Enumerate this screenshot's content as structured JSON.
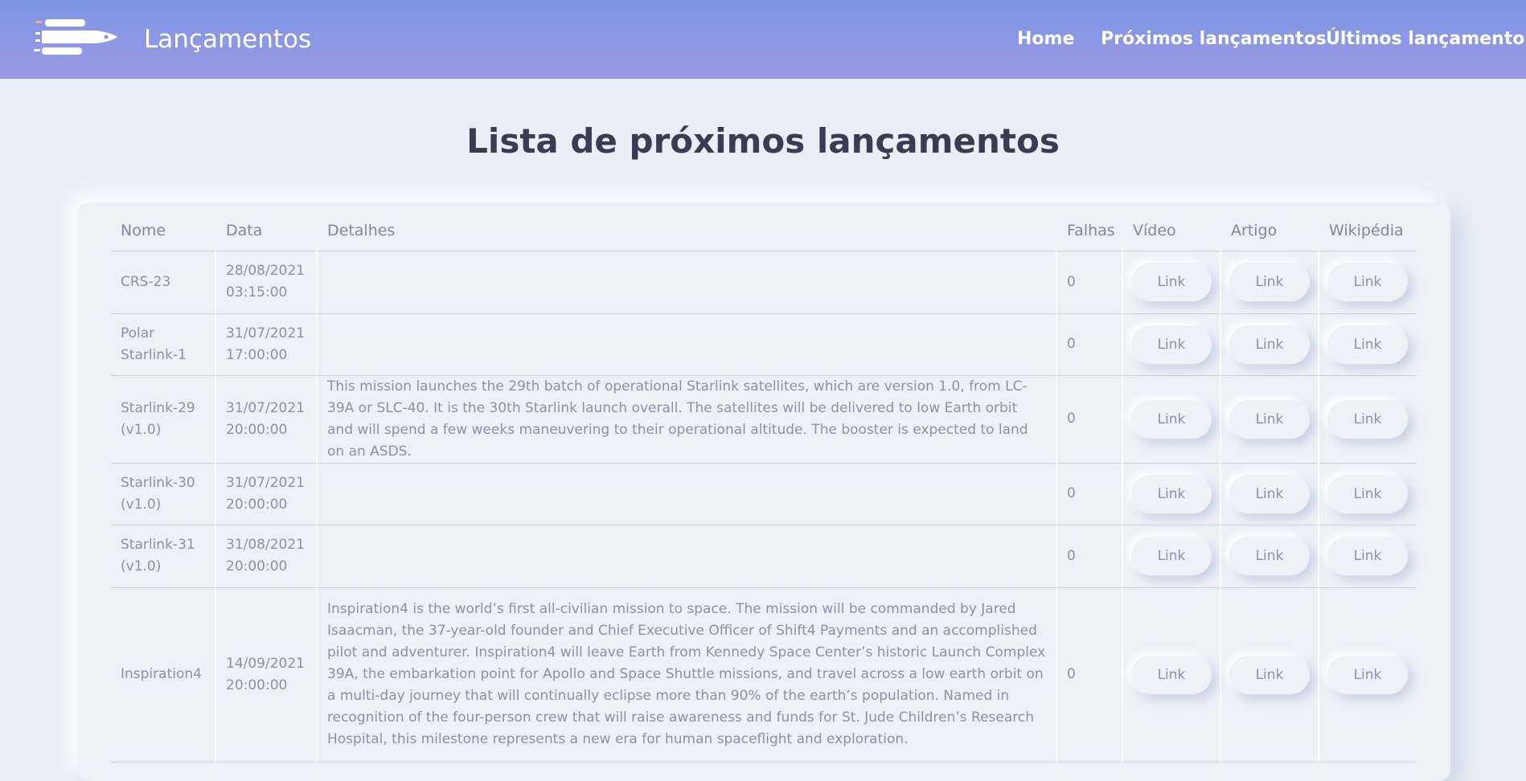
{
  "header": {
    "brand": "Lançamentos",
    "nav": [
      "Home",
      "Próximos lançamentos",
      "Últimos lançamento"
    ]
  },
  "page": {
    "title": "Lista de próximos lançamentos"
  },
  "table": {
    "columns": [
      "Nome",
      "Data",
      "Detalhes",
      "Falhas",
      "Vídeo",
      "Artigo",
      "Wikipédia"
    ],
    "link_label": "Link",
    "rows": [
      {
        "nome": "CRS-23",
        "data": "28/08/2021 03:15:00",
        "detalhes": "",
        "falhas": "0"
      },
      {
        "nome": "Polar Starlink-1",
        "data": "31/07/2021 17:00:00",
        "detalhes": "",
        "falhas": "0"
      },
      {
        "nome": "Starlink-29 (v1.0)",
        "data": "31/07/2021 20:00:00",
        "detalhes": "This mission launches the 29th batch of operational Starlink satellites, which are version 1.0, from LC-39A or SLC-40. It is the 30th Starlink launch overall. The satellites will be delivered to low Earth orbit and will spend a few weeks maneuvering to their operational altitude. The booster is expected to land on an ASDS.",
        "falhas": "0"
      },
      {
        "nome": "Starlink-30 (v1.0)",
        "data": "31/07/2021 20:00:00",
        "detalhes": "",
        "falhas": "0"
      },
      {
        "nome": "Starlink-31 (v1.0)",
        "data": "31/08/2021 20:00:00",
        "detalhes": "",
        "falhas": "0"
      },
      {
        "nome": "Inspiration4",
        "data": "14/09/2021 20:00:00",
        "detalhes": "Inspiration4 is the world’s first all-civilian mission to space. The mission will be commanded by Jared Isaacman, the 37-year-old founder and Chief Executive Officer of Shift4 Payments and an accomplished pilot and adventurer. Inspiration4 will leave Earth from Kennedy Space Center’s historic Launch Complex 39A, the embarkation point for Apollo and Space Shuttle missions, and travel across a low earth orbit on a multi-day journey that will continually eclipse more than 90% of the earth’s population. Named in recognition of the four-person crew that will raise awareness and funds for St. Jude Children’s Research Hospital, this milestone represents a new era for human spaceflight and exploration.",
        "falhas": "0"
      }
    ]
  }
}
